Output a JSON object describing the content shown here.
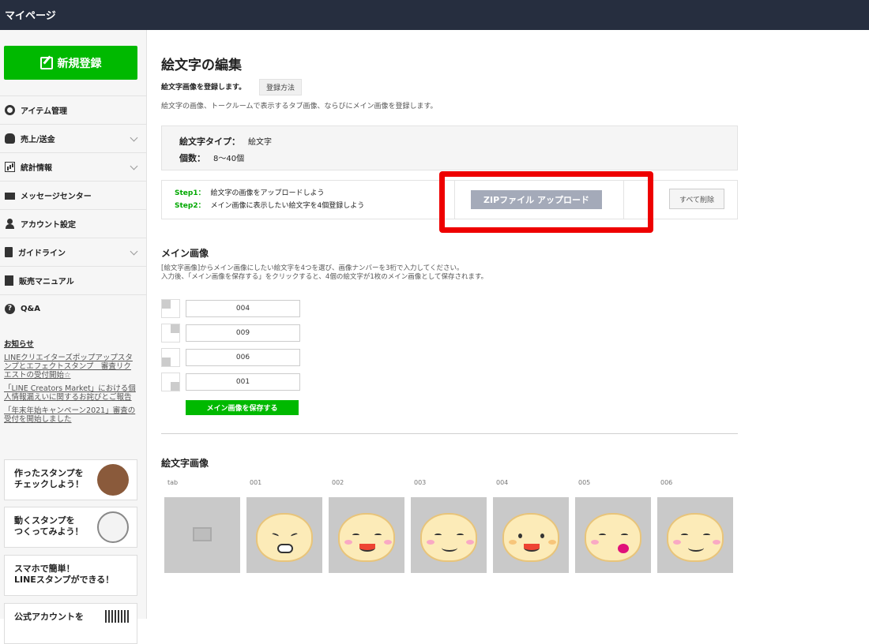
{
  "topbar": {
    "title": "マイページ"
  },
  "sidebar": {
    "new_button": "新規登録",
    "items": [
      {
        "label": "アイテム管理",
        "icon": "gear-icon",
        "has_chevron": false
      },
      {
        "label": "売上/送金",
        "icon": "coins-icon",
        "has_chevron": true
      },
      {
        "label": "統計情報",
        "icon": "chart-icon",
        "has_chevron": true
      },
      {
        "label": "メッセージセンター",
        "icon": "mail-icon",
        "has_chevron": false
      },
      {
        "label": "アカウント設定",
        "icon": "user-icon",
        "has_chevron": false
      },
      {
        "label": "ガイドライン",
        "icon": "document-icon",
        "has_chevron": true
      },
      {
        "label": "販売マニュアル",
        "icon": "book-icon",
        "has_chevron": false
      },
      {
        "label": "Q&A",
        "icon": "question-icon",
        "has_chevron": false
      }
    ],
    "news": {
      "heading": "お知らせ",
      "links": [
        "LINEクリエイターズポップアップスタンプとエフェクトスタンプ　審査リクエストの受付開始☆",
        "「LINE Creators Market」における個人情報漏えいに関するお詫びとご報告",
        "「年末年始キャンペーン2021」審査の受付を開始しました"
      ]
    },
    "promos": [
      {
        "line1": "作ったスタンプを",
        "line2": "チェックしよう！"
      },
      {
        "line1": "動くスタンプを",
        "line2": "つくってみよう！"
      },
      {
        "line1": "スマホで簡単！",
        "line2": "LINEスタンプができる！"
      },
      {
        "line1": "公式アカウントを",
        "line2": ""
      }
    ]
  },
  "main": {
    "title": "絵文字の編集",
    "subtitle": "絵文字画像を登録します。",
    "howto_button": "登録方法",
    "description": "絵文字の画像、トークルームで表示するタブ画像、ならびにメイン画像を登録します。",
    "type_box": {
      "type_label": "絵文字タイプ：",
      "type_value": "絵文字",
      "count_label": "個数：",
      "count_value": "8〜40個"
    },
    "steps": {
      "step1_label": "Step1：",
      "step1_text": "絵文字の画像をアップロードしよう",
      "step2_label": "Step2：",
      "step2_text": "メイン画像に表示したい絵文字を4個登録しよう",
      "zip_button": "ZIPファイル アップロード",
      "delete_button": "すべて削除"
    },
    "main_image": {
      "title": "メイン画像",
      "desc_line1": "[絵文字画像]からメイン画像にしたい絵文字を4つを選び、画像ナンバーを3桁で入力してください。",
      "desc_line2": "入力後、「メイン画像を保存する」をクリックすると、4個の絵文字が1枚のメイン画像として保存されます。",
      "inputs": [
        "004",
        "009",
        "006",
        "001"
      ],
      "save_button": "メイン画像を保存する"
    },
    "emoji_images": {
      "title": "絵文字画像",
      "labels": [
        "tab",
        "001",
        "002",
        "003",
        "004",
        "005",
        "006"
      ]
    }
  }
}
